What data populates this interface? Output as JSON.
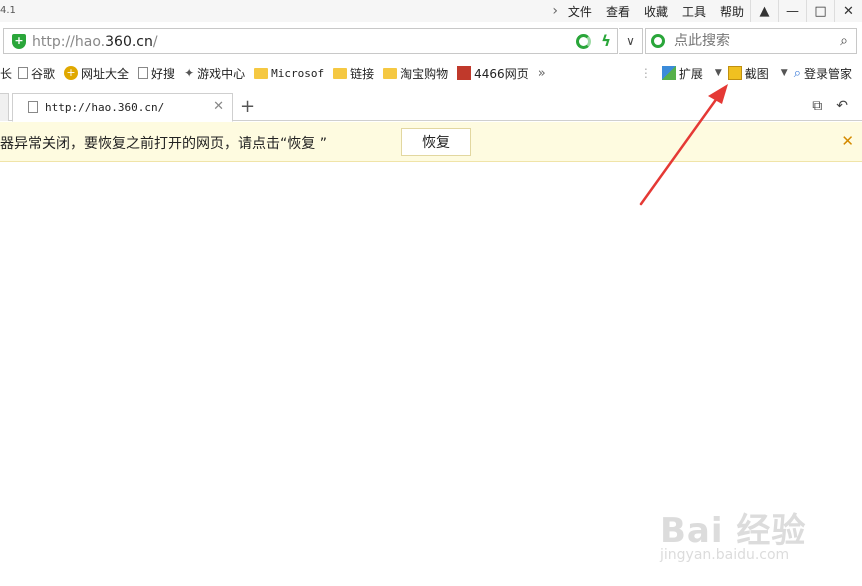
{
  "titlebar": {
    "version": "4.1",
    "menu": [
      "文件",
      "查看",
      "收藏",
      "工具",
      "帮助"
    ],
    "window_controls": [
      "skin-icon",
      "minimize-icon",
      "maximize-icon",
      "close-icon"
    ]
  },
  "address": {
    "url_prefix": "http://hao.",
    "url_domain": "360.cn",
    "url_suffix": "/",
    "search_placeholder": "点此搜索"
  },
  "bookmarks": {
    "items": [
      {
        "label": "谷歌",
        "icon": "page-icon"
      },
      {
        "label": "网址大全",
        "icon": "nav-icon"
      },
      {
        "label": "好搜",
        "icon": "page-icon"
      },
      {
        "label": "游戏中心",
        "icon": "gamepad-icon"
      },
      {
        "label": "Microsof",
        "icon": "folder-icon"
      },
      {
        "label": "链接",
        "icon": "folder-icon"
      },
      {
        "label": "淘宝购物",
        "icon": "folder-icon"
      },
      {
        "label": "4466网页",
        "icon": "grid-icon"
      }
    ],
    "more": "»",
    "extensions_label": "扩展",
    "screenshot_label": "截图",
    "login_label": "登录管家"
  },
  "tabs": {
    "active_title": "http://hao.360.cn/"
  },
  "notice": {
    "message": "器异常关闭，要恢复之前打开的网页，请点击“恢复 ”",
    "restore_label": "恢复"
  },
  "watermark": {
    "logo": "Bai 经验",
    "sub": "jingyan.baidu.com"
  },
  "colors": {
    "accent_green": "#2aa63a",
    "notice_bg": "#fefbe0",
    "annotation_red": "#e53935"
  }
}
